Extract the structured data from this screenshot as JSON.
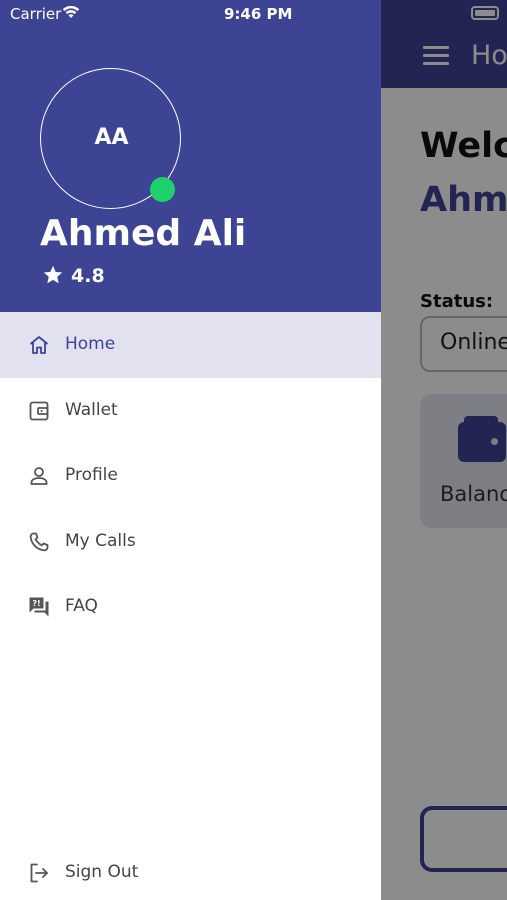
{
  "status_bar": {
    "carrier": "Carrier",
    "time": "9:46 PM"
  },
  "main": {
    "header_title": "Ho",
    "welcome": "Welc",
    "welcome_name": "Ahm",
    "status_label": "Status:",
    "status_value": "Online",
    "balance_label": "Balanc"
  },
  "drawer": {
    "avatar_initials": "AA",
    "user_name": "Ahmed Ali",
    "rating": "4.8",
    "menu": [
      {
        "label": "Home",
        "icon": "home-icon",
        "active": true
      },
      {
        "label": "Wallet",
        "icon": "wallet-icon"
      },
      {
        "label": "Profile",
        "icon": "person-icon"
      },
      {
        "label": "My Calls",
        "icon": "phone-icon"
      },
      {
        "label": "FAQ",
        "icon": "faq-icon"
      }
    ],
    "sign_out": {
      "label": "Sign Out",
      "icon": "sign-out-icon"
    }
  },
  "colors": {
    "primary": "#3e4494",
    "active_bg": "#e1e1f0",
    "online": "#1fd16a"
  }
}
